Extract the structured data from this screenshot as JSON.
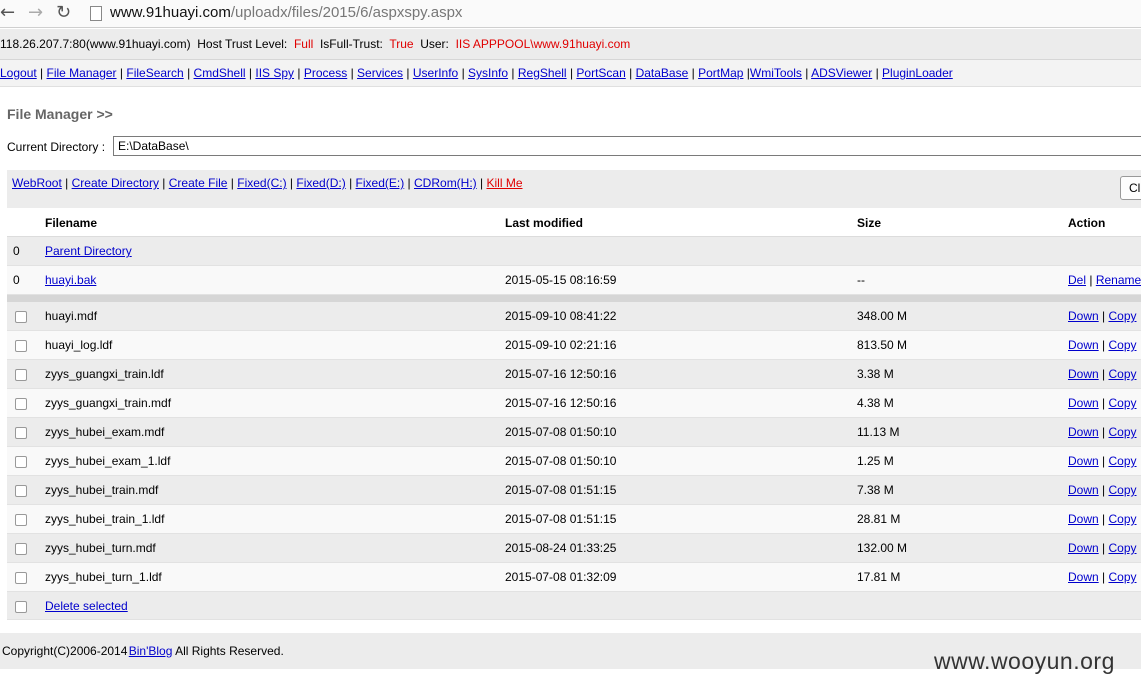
{
  "browser": {
    "back": "←",
    "forward": "→",
    "reload": "↻",
    "url_host": "www.91huayi.com",
    "url_path": "/uploadx/files/2015/6/aspxspy.aspx"
  },
  "info": {
    "server": "118.26.207.7:80(www.91huayi.com)",
    "trust_label": "Host Trust Level:",
    "trust_value": "Full",
    "isfull_label": "IsFull-Trust:",
    "isfull_value": "True",
    "user_label": "User:",
    "user_value": "IIS APPPOOL\\www.91huayi.com"
  },
  "menu": [
    "Logout",
    "File Manager",
    "FileSearch",
    "CmdShell",
    "IIS Spy",
    "Process",
    "Services",
    "UserInfo",
    "SysInfo",
    "RegShell",
    "PortScan",
    "DataBase",
    "PortMap",
    "WmiTools",
    "ADSViewer",
    "PluginLoader"
  ],
  "title": "File Manager >>",
  "current_directory": {
    "label": "Current Directory :",
    "value": "E:\\DataBase\\"
  },
  "quick_links": [
    "WebRoot",
    "Create Directory",
    "Create File",
    "Fixed(C:)",
    "Fixed(D:)",
    "Fixed(E:)",
    "CDRom(H:)"
  ],
  "kill_me": "Kill Me",
  "cl_button": "Cl",
  "table": {
    "headers": {
      "filename": "Filename",
      "modified": "Last modified",
      "size": "Size",
      "action": "Action"
    },
    "parent_row": {
      "num": "0",
      "name": "Parent Directory"
    },
    "dir_row": {
      "num": "0",
      "name": "huayi.bak",
      "modified": "2015-05-15 08:16:59",
      "size": "--",
      "del": "Del",
      "rename": "Rename"
    },
    "files": [
      {
        "name": "huayi.mdf",
        "modified": "2015-09-10 08:41:22",
        "size": "348.00 M"
      },
      {
        "name": "huayi_log.ldf",
        "modified": "2015-09-10 02:21:16",
        "size": "813.50 M"
      },
      {
        "name": "zyys_guangxi_train.ldf",
        "modified": "2015-07-16 12:50:16",
        "size": "3.38 M"
      },
      {
        "name": "zyys_guangxi_train.mdf",
        "modified": "2015-07-16 12:50:16",
        "size": "4.38 M"
      },
      {
        "name": "zyys_hubei_exam.mdf",
        "modified": "2015-07-08 01:50:10",
        "size": "11.13 M"
      },
      {
        "name": "zyys_hubei_exam_1.ldf",
        "modified": "2015-07-08 01:50:10",
        "size": "1.25 M"
      },
      {
        "name": "zyys_hubei_train.mdf",
        "modified": "2015-07-08 01:51:15",
        "size": "7.38 M"
      },
      {
        "name": "zyys_hubei_train_1.ldf",
        "modified": "2015-07-08 01:51:15",
        "size": "28.81 M"
      },
      {
        "name": "zyys_hubei_turn.mdf",
        "modified": "2015-08-24 01:33:25",
        "size": "132.00 M"
      },
      {
        "name": "zyys_hubei_turn_1.ldf",
        "modified": "2015-07-08 01:32:09",
        "size": "17.81 M"
      }
    ],
    "file_actions": {
      "down": "Down",
      "copy": "Copy"
    },
    "delete_selected": "Delete selected"
  },
  "footer": {
    "copyright": "Copyright(C)2006-2014",
    "blog": "Bin'Blog",
    "rights": "All Rights Reserved."
  },
  "watermark": "www.wooyun.org"
}
